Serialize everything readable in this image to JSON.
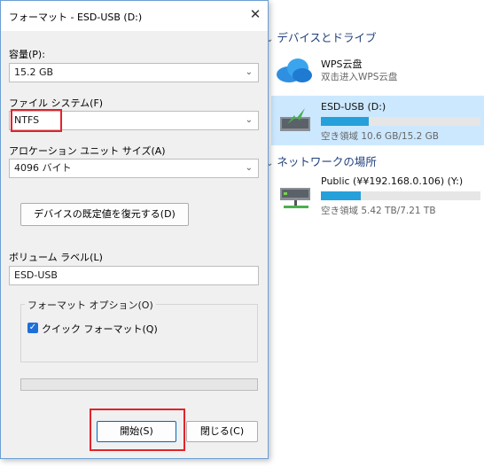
{
  "dialog": {
    "title": "フォーマット - ESD-USB (D:)",
    "capacity_label": "容量(P):",
    "capacity_value": "15.2 GB",
    "fs_label": "ファイル システム(F)",
    "fs_value": "NTFS",
    "alloc_label": "アロケーション ユニット サイズ(A)",
    "alloc_value": "4096 バイト",
    "restore_button": "デバイスの既定値を復元する(D)",
    "volume_label": "ボリューム ラベル(L)",
    "volume_value": "ESD-USB",
    "options_title": "フォーマット オプション(O)",
    "quick_format": "クイック フォーマット(Q)",
    "quick_format_checked": true,
    "start_button": "開始(S)",
    "close_button": "閉じる(C)"
  },
  "explorer": {
    "devices_header": "デバイスとドライブ",
    "network_header": "ネットワークの場所",
    "drives": [
      {
        "name": "WPS云盘",
        "sub": "双击进入WPS云盘",
        "icon": "cloud-icon"
      },
      {
        "name": "ESD-USB (D:)",
        "sub": "空き領域 10.6 GB/15.2 GB",
        "icon": "usb-drive-icon",
        "used_fraction": 0.3,
        "selected": true
      },
      {
        "name": "Public (¥¥192.168.0.106) (Y:)",
        "sub": "空き領域 5.42 TB/7.21 TB",
        "icon": "network-drive-icon",
        "used_fraction": 0.25
      }
    ]
  },
  "colors": {
    "accent": "#26a0da",
    "highlight": "#e2232a",
    "selection": "#cce8ff"
  }
}
